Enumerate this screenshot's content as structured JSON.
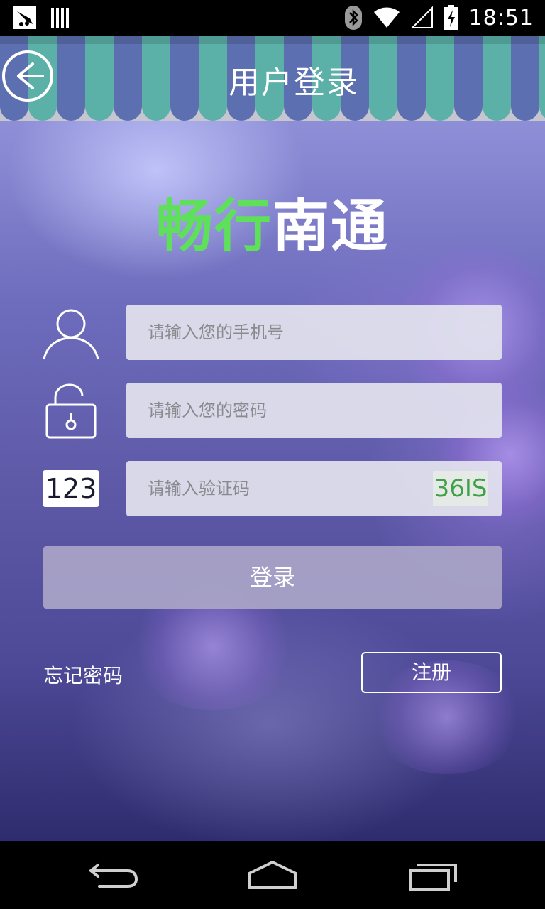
{
  "status_bar": {
    "time": "18:51",
    "icons": [
      "notification-icon",
      "barcode-icon",
      "bluetooth-icon",
      "wifi-icon",
      "signal-icon",
      "battery-icon"
    ]
  },
  "header": {
    "title": "用户登录",
    "back_icon": "back-arrow-icon",
    "colors": {
      "stripe_blue": "#5c6fb0",
      "stripe_teal": "#5bb0a8"
    }
  },
  "logo": {
    "part1": "畅行",
    "part2": "南通",
    "colors": {
      "part1": "#5fe05a",
      "part2": "#ffffff"
    }
  },
  "form": {
    "phone": {
      "icon": "user-icon",
      "placeholder": "请输入您的手机号",
      "value": ""
    },
    "password": {
      "icon": "unlock-icon",
      "placeholder": "请输入您的密码",
      "value": ""
    },
    "code": {
      "badge": "123",
      "placeholder": "请输入验证码",
      "value": "",
      "captcha": "36IS"
    }
  },
  "actions": {
    "login_label": "登录",
    "forgot_label": "忘记密码",
    "register_label": "注册"
  },
  "nav_bar": {
    "icons": [
      "back-nav-icon",
      "home-nav-icon",
      "recents-nav-icon"
    ]
  }
}
